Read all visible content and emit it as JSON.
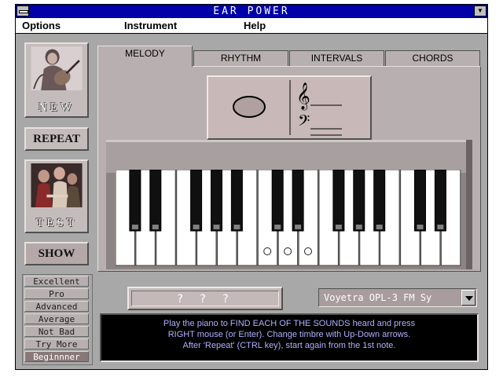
{
  "window": {
    "title": "EAR POWER"
  },
  "menu": [
    "Options",
    "Instrument",
    "Help"
  ],
  "left": {
    "new_label": "NEW",
    "repeat_label": "REPEAT",
    "test_label": "TEST",
    "show_label": "SHOW"
  },
  "levels": [
    "Excellent",
    "Pro",
    "Advanced",
    "Average",
    "Not Bad",
    "Try More",
    "Beginnner"
  ],
  "selected_level": "Beginnner",
  "tabs": [
    "MELODY",
    "RHYTHM",
    "INTERVALS",
    "CHORDS"
  ],
  "active_tab": "MELODY",
  "answer_text": "? ? ?",
  "instrument_select": {
    "value": "Voyetra OPL-3 FM Sy"
  },
  "message": [
    "Play the piano to FIND EACH OF THE SOUNDS heard and press",
    "RIGHT mouse (or Enter). Change timbre with Up-Down arrows.",
    "After 'Repeat' (CTRL key), start again from the 1st note."
  ],
  "colors": {
    "titlebar": "#0000a8",
    "background": "#a8a8a8",
    "message_text": "#b0b0ff"
  },
  "icons": [
    "system-menu-icon",
    "minimize-icon",
    "whole-note-icon",
    "treble-clef-icon",
    "bass-clef-icon",
    "dropdown-arrow-icon"
  ]
}
